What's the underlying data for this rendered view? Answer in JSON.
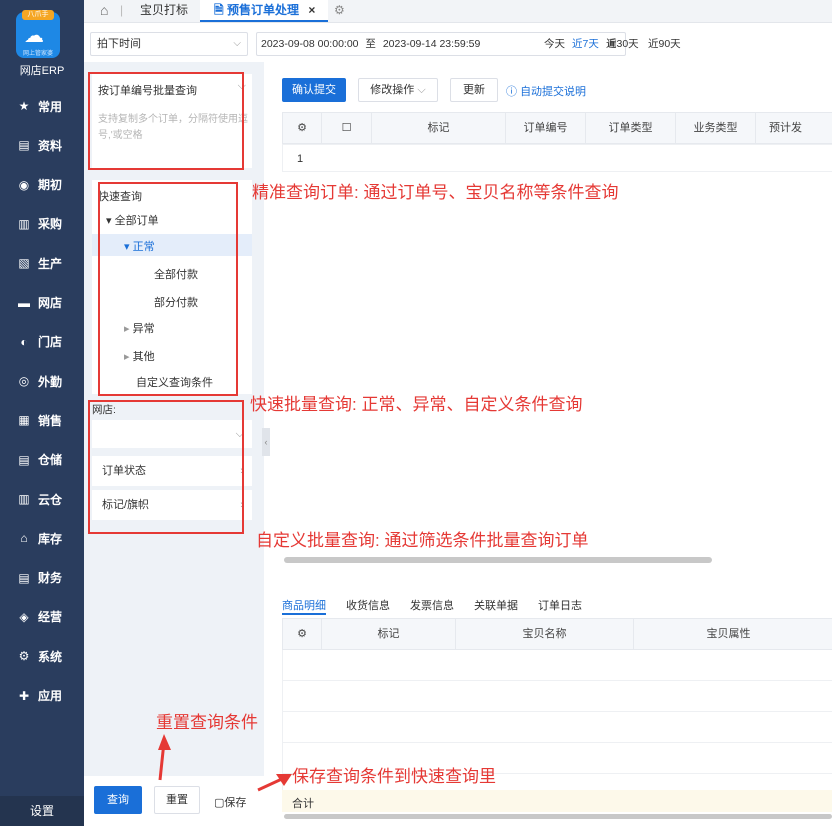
{
  "leftnav": {
    "logo_badge": "八爪手",
    "logo_sub": "网上管家婆",
    "app_name": "网店ERP",
    "items": [
      {
        "label": "常用",
        "icon": "star-icon"
      },
      {
        "label": "资料",
        "icon": "document-icon"
      },
      {
        "label": "期初",
        "icon": "circle-icon"
      },
      {
        "label": "采购",
        "icon": "cart-icon"
      },
      {
        "label": "生产",
        "icon": "factory-icon"
      },
      {
        "label": "网店",
        "icon": "store-icon"
      },
      {
        "label": "门店",
        "icon": "shop-icon"
      },
      {
        "label": "外勤",
        "icon": "field-icon"
      },
      {
        "label": "销售",
        "icon": "sales-icon"
      },
      {
        "label": "仓储",
        "icon": "warehouse-icon"
      },
      {
        "label": "云仓",
        "icon": "cloud-warehouse-icon"
      },
      {
        "label": "库存",
        "icon": "inventory-icon"
      },
      {
        "label": "财务",
        "icon": "finance-icon"
      },
      {
        "label": "经营",
        "icon": "business-icon"
      },
      {
        "label": "系统",
        "icon": "gear-icon"
      },
      {
        "label": "应用",
        "icon": "plus-icon"
      }
    ],
    "settings": "设置"
  },
  "tabs": {
    "home_icon": "home-icon",
    "tab1": "宝贝打标",
    "tab2": "预售订单处理",
    "close": "×"
  },
  "filter": {
    "time_type": "拍下时间",
    "date_from": "2023-09-08 00:00:00",
    "date_sep": "至",
    "date_to": "2023-09-14 23:59:59",
    "quick": [
      "今天",
      "近7天",
      "近30天",
      "近90天"
    ]
  },
  "panel": {
    "batch_title": "按订单编号批量查询",
    "batch_placeholder": "支持复制多个订单，分隔符使用逗号,'或空格",
    "quick_title": "快速查询",
    "tree": {
      "all": "全部订单",
      "normal": "正常",
      "all_paid": "全部付款",
      "part_paid": "部分付款",
      "abnormal": "异常",
      "other": "其他",
      "custom": "自定义查询条件"
    },
    "shop_label": "网店:",
    "order_status": "订单状态",
    "flag": "标记/旗帜",
    "btn_query": "查询",
    "btn_reset": "重置",
    "btn_save": "保存"
  },
  "toolbar": {
    "confirm": "确认提交",
    "modify": "修改操作",
    "update": "更新",
    "auto_help": "自动提交说明"
  },
  "grid": {
    "columns": [
      "标记",
      "订单编号",
      "订单类型",
      "业务类型",
      "预计发"
    ],
    "row1": "1"
  },
  "detail": {
    "tabs": [
      "商品明细",
      "收货信息",
      "发票信息",
      "关联单据",
      "订单日志"
    ],
    "columns": [
      "标记",
      "宝贝名称",
      "宝贝属性"
    ],
    "total": "合计"
  },
  "annotations": {
    "a1": "精准查询订单: 通过订单号、宝贝名称等条件查询",
    "a2": "快速批量查询: 正常、异常、自定义条件查询",
    "a3": "自定义批量查询: 通过筛选条件批量查询订单",
    "a4": "重置查询条件",
    "a5": "保存查询条件到快速查询里"
  },
  "colors": {
    "nav": "#2a3d5e",
    "primary": "#1a6fd8",
    "annotation": "#e53935",
    "panel": "#eef2f7"
  }
}
